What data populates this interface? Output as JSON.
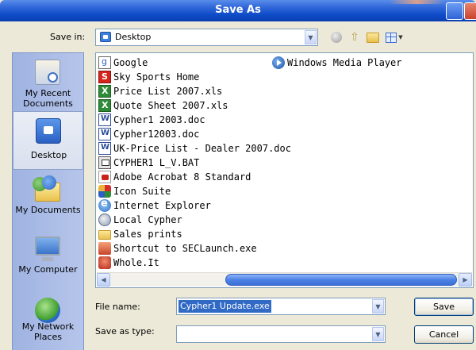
{
  "window": {
    "title": "Save As"
  },
  "toolbar": {
    "save_in_label": "Save in:",
    "save_in_value": "Desktop"
  },
  "places": [
    {
      "label": "My Recent Documents"
    },
    {
      "label": "Desktop"
    },
    {
      "label": "My Documents"
    },
    {
      "label": "My Computer"
    },
    {
      "label": "My Network Places"
    }
  ],
  "files": [
    {
      "name": "Google"
    },
    {
      "name": "Sky Sports  Home"
    },
    {
      "name": "Price List 2007.xls"
    },
    {
      "name": "Quote Sheet 2007.xls"
    },
    {
      "name": "Cypher1 2003.doc"
    },
    {
      "name": "Cypher12003.doc"
    },
    {
      "name": "UK-Price List - Dealer 2007.doc"
    },
    {
      "name": "CYPHER1 L_V.BAT"
    },
    {
      "name": "Adobe Acrobat 8 Standard"
    },
    {
      "name": "Icon Suite"
    },
    {
      "name": "Internet Explorer"
    },
    {
      "name": "Local Cypher"
    },
    {
      "name": "Sales prints"
    },
    {
      "name": "Shortcut to SECLaunch.exe"
    },
    {
      "name": "Whole.It"
    },
    {
      "name": "Windows Media Player"
    }
  ],
  "form": {
    "file_name_label": "File name:",
    "file_name_value": "Cypher1 Update.exe",
    "save_as_type_label": "Save as type:",
    "save_as_type_value": ""
  },
  "buttons": {
    "save": "Save",
    "cancel": "Cancel"
  },
  "colors": {
    "title_bar": "#0F4BC8",
    "selection": "#316AC5",
    "dialog_bg": "#ECE9D8"
  }
}
